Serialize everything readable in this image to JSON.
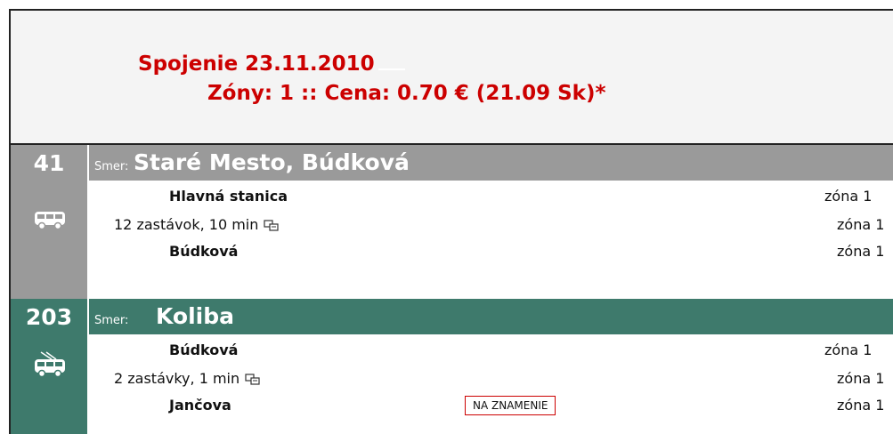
{
  "header": {
    "title": "Spojenie 23.11.2010",
    "fare": "Zóny: 1 :: Cena: 0.70 € (21.09 Sk)*"
  },
  "legs": [
    {
      "line": "41",
      "vehicle": "bus-icon",
      "direction_label": "Smer:",
      "direction": "Staré Mesto, Búdková",
      "from": {
        "stop": "Hlavná stanica",
        "zone": "zóna 1"
      },
      "info": {
        "text": "12 zastávok, 10 min",
        "zone": "zóna 1"
      },
      "to": {
        "stop": "Búdková",
        "zone": "zóna 1"
      }
    },
    {
      "line": "203",
      "vehicle": "trolleybus-icon",
      "direction_label": "Smer:",
      "direction": "Koliba",
      "from": {
        "stop": "Búdková",
        "zone": "zóna 1"
      },
      "info": {
        "text": "2 zastávky, 1 min",
        "zone": "zóna 1"
      },
      "to": {
        "stop": "Jančova",
        "zone": "zóna 1",
        "request_stop": "NA ZNAMENIE"
      }
    }
  ],
  "colors": {
    "accent_red": "#cc0000",
    "bus_gray": "#9a9a9a",
    "trolley_green": "#3e7a6c"
  }
}
